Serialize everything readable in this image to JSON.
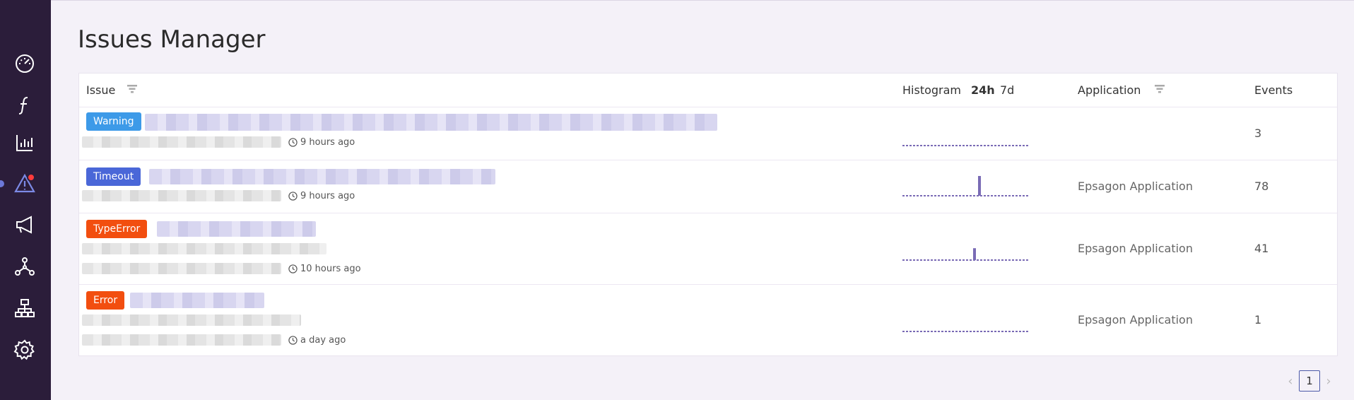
{
  "page": {
    "title": "Issues Manager"
  },
  "sidebar": {
    "items": [
      {
        "icon": "dashboard-gauge-icon"
      },
      {
        "icon": "function-icon"
      },
      {
        "icon": "metrics-chart-icon"
      },
      {
        "icon": "alert-triangle-icon",
        "active": true,
        "has_notification": true
      },
      {
        "icon": "megaphone-icon"
      },
      {
        "icon": "service-map-icon"
      },
      {
        "icon": "hierarchy-icon"
      },
      {
        "icon": "settings-gear-icon"
      }
    ]
  },
  "table": {
    "headers": {
      "issue": "Issue",
      "histogram": "Histogram",
      "range_24h": "24h",
      "range_7d": "7d",
      "application": "Application",
      "events": "Events"
    },
    "rows": [
      {
        "badge": "Warning",
        "badge_color": "#3d9ae8",
        "time": "9 hours ago",
        "application": "",
        "events": "3",
        "histogram_peak": 0
      },
      {
        "badge": "Timeout",
        "badge_color": "#4a67d8",
        "time": "9 hours ago",
        "application": "Epsagon Application",
        "events": "78",
        "histogram_peak": 1
      },
      {
        "badge": "TypeError",
        "badge_color": "#f24e0f",
        "time": "10 hours ago",
        "application": "Epsagon Application",
        "events": "41",
        "histogram_peak": 0.6
      },
      {
        "badge": "Error",
        "badge_color": "#f24e0f",
        "time": "a day ago",
        "application": "Epsagon Application",
        "events": "1",
        "histogram_peak": 0
      }
    ]
  },
  "pagination": {
    "current_page": "1",
    "prev": "‹",
    "next": "›"
  },
  "colors": {
    "sidebar": "#2b1d3a",
    "accent": "#6c78d8",
    "histogram": "#7a6bb5"
  }
}
